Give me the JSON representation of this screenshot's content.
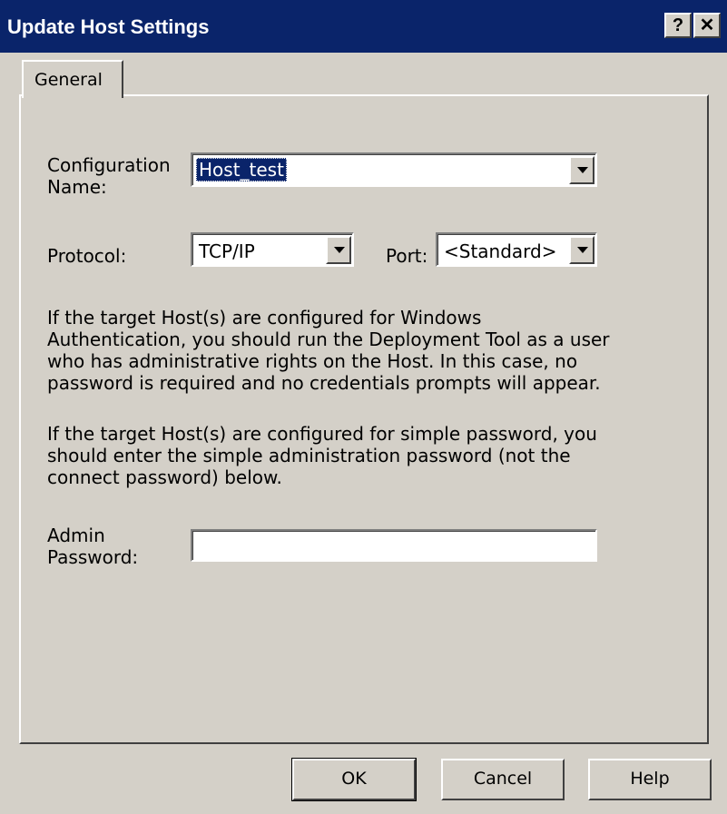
{
  "window": {
    "title": "Update Host Settings",
    "help_button": "?",
    "close_button": "✕"
  },
  "tabs": [
    {
      "label": "General",
      "active": true
    }
  ],
  "form": {
    "config_name_label_line1": "Configuration",
    "config_name_label_line2": "Name:",
    "config_name_value": "Host_test",
    "protocol_label": "Protocol:",
    "protocol_value": "TCP/IP",
    "port_label": "Port:",
    "port_value": "<Standard>",
    "admin_password_label_line1": "Admin",
    "admin_password_label_line2": "Password:",
    "admin_password_value": ""
  },
  "info": {
    "paragraph1": [
      "If the target Host(s) are configured for Windows",
      "Authentication, you should run the Deployment Tool as a user",
      "who has administrative rights on the Host.  In this case, no",
      "password is required and no credentials prompts will appear."
    ],
    "paragraph2": [
      "If the target Host(s) are configured for simple password, you",
      "should enter the simple administration password (not the",
      "connect password) below."
    ]
  },
  "buttons": {
    "ok": "OK",
    "cancel": "Cancel",
    "help": "Help"
  },
  "colors": {
    "titlebar": "#0a246a",
    "face": "#d4d0c8",
    "selection": "#0a246a"
  },
  "icons": {
    "dropdown": "chevron-down-icon",
    "help": "question-icon",
    "close": "close-icon"
  }
}
